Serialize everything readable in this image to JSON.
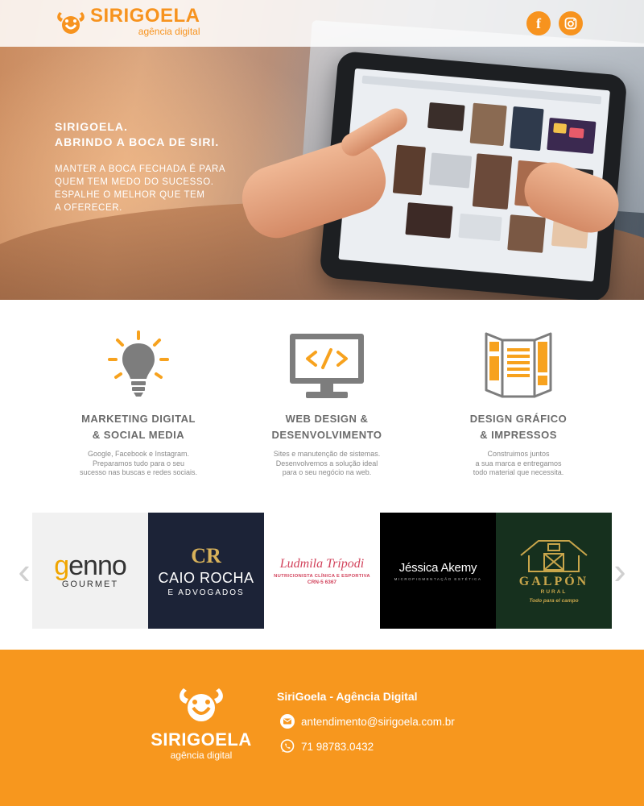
{
  "brand": {
    "name": "SIRIGOELA",
    "tagline": "agência digital",
    "primary_color": "#f7931e"
  },
  "header": {
    "social": [
      {
        "name": "facebook",
        "glyph": "f",
        "icon": "facebook-icon"
      },
      {
        "name": "instagram",
        "icon": "instagram-icon"
      }
    ]
  },
  "hero": {
    "title_line1": "SIRIGOELA.",
    "title_line2": "ABRINDO A BOCA DE SIRI.",
    "body_lines": [
      "MANTER A BOCA FECHADA É PARA",
      "QUEM TEM MEDO DO SUCESSO.",
      "ESPALHE O MELHOR QUE TEM",
      "A OFERECER."
    ]
  },
  "services": [
    {
      "icon": "lightbulb-icon",
      "title_lines": [
        "MARKETING DIGITAL",
        "& SOCIAL MEDIA"
      ],
      "desc_lines": [
        "Google, Facebook e Instagram.",
        "Preparamos tudo para o seu",
        "sucesso nas buscas e redes sociais."
      ]
    },
    {
      "icon": "monitor-code-icon",
      "title_lines": [
        "WEB DESIGN &",
        "DESENVOLVIMENTO"
      ],
      "desc_lines": [
        "Sites e manutenção de sistemas.",
        "Desenvolvemos a solução ideal",
        "para o seu negócio na web."
      ]
    },
    {
      "icon": "brochure-icon",
      "title_lines": [
        "DESIGN GRÁFICO",
        "& IMPRESSOS"
      ],
      "desc_lines": [
        "Construimos juntos",
        "a sua marca e entregamos",
        "todo material que necessita."
      ]
    }
  ],
  "clients": {
    "prev_glyph": "‹",
    "next_glyph": "›",
    "items": [
      {
        "brand_a": "g",
        "brand_b": "enno",
        "sub": "GOURMET"
      },
      {
        "mark": "CR",
        "name": "CAIO ROCHA",
        "sub": "E ADVOGADOS"
      },
      {
        "name": "Ludmila Trípodi",
        "sub": "NUTRICIONISTA CLÍNICA E ESPORTIVA",
        "crn": "CRN-5 6367"
      },
      {
        "name": "Jéssica Akemy",
        "sub": "MICROPIGMENTAÇÃO ESTÉTICA"
      },
      {
        "name": "GALPÓN",
        "sub1": "RURAL",
        "sub2": "Todo para el campo"
      }
    ]
  },
  "footer": {
    "title": "SiriGoela - Agência Digital",
    "email": "antendimento@sirigoela.com.br",
    "phone": "71 98783.0432"
  }
}
